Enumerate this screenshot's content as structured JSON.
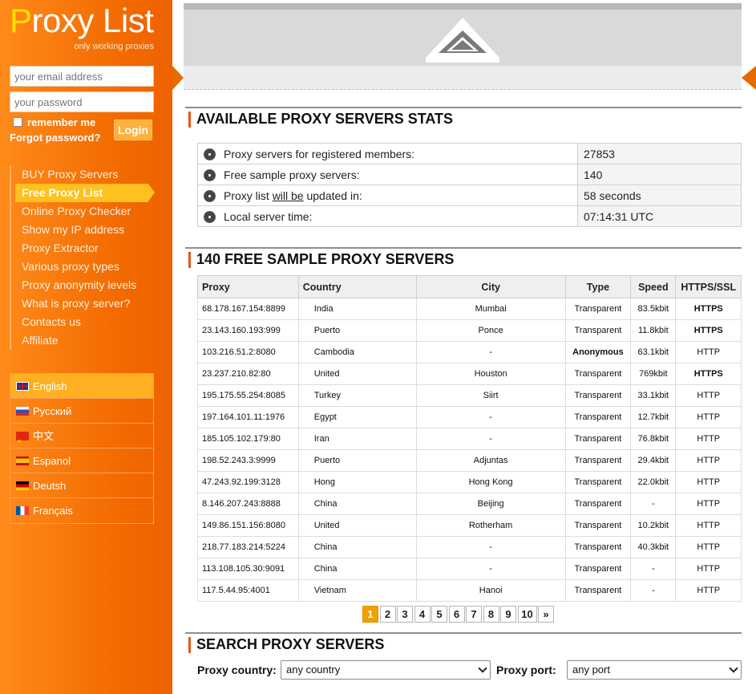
{
  "sidebar": {
    "logo": {
      "first_letter": "P",
      "rest": "roxy List",
      "tagline": "only working proxies"
    },
    "login": {
      "email_placeholder": "your email address",
      "password_placeholder": "your password",
      "remember_label": "remember me",
      "forgot_label": "Forgot password?",
      "login_button": "Login"
    },
    "nav": [
      {
        "label": "BUY Proxy Servers",
        "active": false
      },
      {
        "label": "Free Proxy List",
        "active": true
      },
      {
        "label": "Online Proxy Checker",
        "active": false
      },
      {
        "label": "Show my IP address",
        "active": false
      },
      {
        "label": "Proxy Extractor",
        "active": false
      },
      {
        "label": "Various proxy types",
        "active": false
      },
      {
        "label": "Proxy anonymity levels",
        "active": false
      },
      {
        "label": "What is proxy server?",
        "active": false
      },
      {
        "label": "Contacts us",
        "active": false
      },
      {
        "label": "Affiliate",
        "active": false
      }
    ],
    "languages": [
      {
        "label": "English",
        "flag": "uk-flag-icon",
        "active": true
      },
      {
        "label": "Русский",
        "flag": "russia-flag-icon",
        "active": false
      },
      {
        "label": "中文",
        "flag": "china-flag-icon",
        "active": false
      },
      {
        "label": "Espanol",
        "flag": "spain-flag-icon",
        "active": false
      },
      {
        "label": "Deutsh",
        "flag": "germany-flag-icon",
        "active": false
      },
      {
        "label": "Français",
        "flag": "france-flag-icon",
        "active": false
      }
    ]
  },
  "stats": {
    "title": "AVAILABLE PROXY SERVERS STATS",
    "rows": [
      {
        "label": "Proxy servers for registered members:",
        "value": "27853"
      },
      {
        "label_before": "Proxy list ",
        "label_underline": "will be",
        "label_after": " updated in:",
        "value": "58 seconds"
      },
      {
        "label": "Free sample proxy servers:",
        "value": "140"
      },
      {
        "label": "Local server time:",
        "value": "07:14:31 UTC"
      }
    ]
  },
  "proxies": {
    "title": "140 FREE SAMPLE PROXY SERVERS",
    "headers": [
      "Proxy",
      "Country",
      "City",
      "Type",
      "Speed",
      "HTTPS/SSL"
    ],
    "rows": [
      [
        "68.178.167.154:8899",
        "India",
        "Mumbai",
        "Transparent",
        "83.5kbit",
        "HTTPS"
      ],
      [
        "23.143.160.193:999",
        "Puerto",
        "Ponce",
        "Transparent",
        "11.8kbit",
        "HTTPS"
      ],
      [
        "103.216.51.2:8080",
        "Cambodia",
        "-",
        "Anonymous",
        "63.1kbit",
        "HTTP"
      ],
      [
        "23.237.210.82:80",
        "United",
        "Houston",
        "Transparent",
        "769kbit",
        "HTTPS"
      ],
      [
        "195.175.55.254:8085",
        "Turkey",
        "Siirt",
        "Transparent",
        "33.1kbit",
        "HTTP"
      ],
      [
        "197.164.101.11:1976",
        "Egypt",
        "-",
        "Transparent",
        "12.7kbit",
        "HTTP"
      ],
      [
        "185.105.102.179:80",
        "Iran",
        "-",
        "Transparent",
        "76.8kbit",
        "HTTP"
      ],
      [
        "198.52.243.3:9999",
        "Puerto",
        "Adjuntas",
        "Transparent",
        "29.4kbit",
        "HTTP"
      ],
      [
        "47.243.92.199:3128",
        "Hong",
        "Hong Kong",
        "Transparent",
        "22.0kbit",
        "HTTP"
      ],
      [
        "8.146.207.243:8888",
        "China",
        "Beijing",
        "Transparent",
        "-",
        "HTTP"
      ],
      [
        "149.86.151.156:8080",
        "United",
        "Rotherham",
        "Transparent",
        "10.2kbit",
        "HTTP"
      ],
      [
        "218.77.183.214:5224",
        "China",
        "-",
        "Transparent",
        "40.3kbit",
        "HTTP"
      ],
      [
        "113.108.105.30:9091",
        "China",
        "-",
        "Transparent",
        "-",
        "HTTP"
      ],
      [
        "117.5.44.95:4001",
        "Vietnam",
        "Hanoi",
        "Transparent",
        "-",
        "HTTP"
      ]
    ],
    "pages": [
      "1",
      "2",
      "3",
      "4",
      "5",
      "6",
      "7",
      "8",
      "9",
      "10",
      "»"
    ],
    "current_page": "1"
  },
  "search": {
    "title": "SEARCH PROXY SERVERS",
    "country_label": "Proxy country:",
    "country_value": "any country",
    "port_label": "Proxy port:",
    "port_value": "any port"
  },
  "colors": {
    "sidebar": "#f26a00",
    "highlight": "#ffc020",
    "accent": "#e5561a",
    "green": "#22aa22"
  }
}
